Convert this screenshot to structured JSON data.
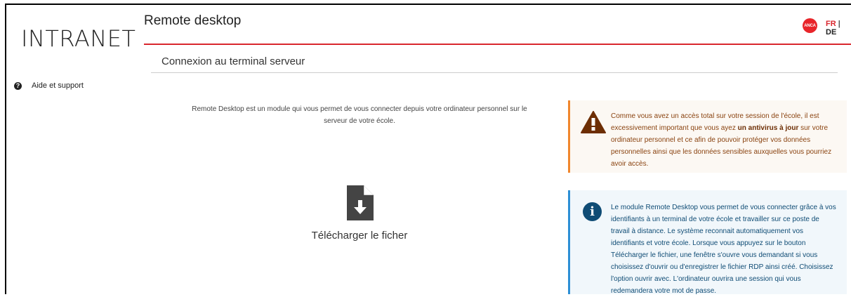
{
  "sidebar": {
    "logo": "INTRANET",
    "help_label": "Aide et support",
    "help_icon": "question-circle-icon"
  },
  "header": {
    "title": "Remote desktop",
    "avatar_text": "ANCA",
    "lang_fr": "FR",
    "lang_sep": " | ",
    "lang_de": "DE",
    "accent_color": "#d9262d"
  },
  "main": {
    "subtitle": "Connexion au terminal serveur",
    "intro": "Remote Desktop est un module qui vous permet de vous connecter depuis votre ordinateur personnel sur le serveur de votre école.",
    "download_label": "Télécharger le ficher",
    "download_icon": "file-download-icon"
  },
  "warning": {
    "icon": "warning-triangle-icon",
    "text_before": "Comme vous avez un accès total sur votre session de l'école, il est excessivement important que vous ayez ",
    "text_bold": "un antivirus à jour",
    "text_after": " sur votre ordinateur personnel et ce afin de pouvoir protéger vos données personnelles ainsi que les données sensibles auxquelles vous pourriez avoir accès.",
    "border_color": "#f0862d"
  },
  "info": {
    "icon": "info-circle-icon",
    "icon_glyph": "i",
    "text": "Le module Remote Desktop vous permet de vous connecter grâce à vos identifiants à un terminal de votre école et travailler sur ce poste de travail à distance. Le système reconnait automatiquement vos identifiants et votre école. Lorsque vous appuyez sur le bouton Télécharger le fichier, une fenêtre s'ouvre vous demandant si vous choisissez d'ouvrir ou d'enregistrer le fichier RDP ainsi créé. Choisissez l'option ouvrir avec. L'ordinateur ouvrira une session qui vous redemandera votre mot de passe.",
    "border_color": "#2d8fd5"
  }
}
